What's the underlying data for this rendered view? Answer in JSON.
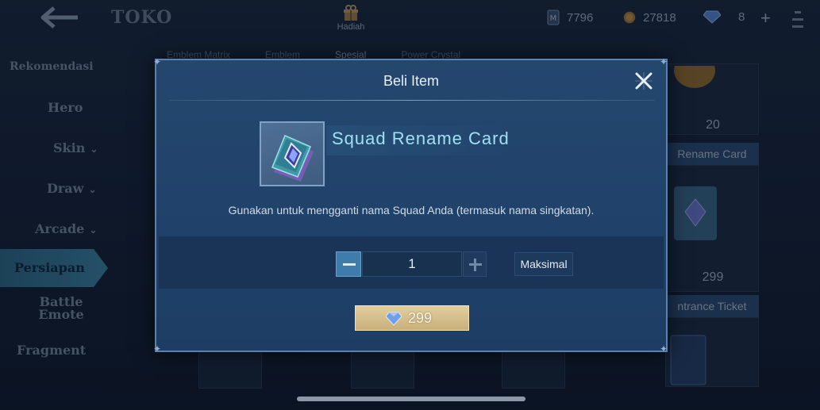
{
  "screen": {
    "title": "TOKO",
    "gift_label": "Hadiah"
  },
  "currencies": [
    {
      "name": "matrix-token",
      "value": "7796"
    },
    {
      "name": "battle-point",
      "value": "27818"
    },
    {
      "name": "diamond",
      "value": "8"
    }
  ],
  "sidebar": {
    "items": [
      {
        "label": "Rekomendasi"
      },
      {
        "label": "Hero"
      },
      {
        "label": "Skin"
      },
      {
        "label": "Draw"
      },
      {
        "label": "Arcade"
      },
      {
        "label": "Persiapan"
      },
      {
        "label": "Battle Emote"
      },
      {
        "label": "Fragment"
      }
    ]
  },
  "tabs": [
    "Emblem Matrix",
    "Emblem",
    "Spesial",
    "Power Crystal"
  ],
  "background_cards": {
    "price_1": "20",
    "name_2": "Rename Card",
    "price_2": "299",
    "name_3": "ntrance Ticket"
  },
  "modal": {
    "title": "Beli Item",
    "item_name": "Squad Rename Card",
    "description": "Gunakan untuk mengganti nama Squad Anda (termasuk nama singkatan).",
    "quantity": "1",
    "max_label": "Maksimal",
    "price": "299"
  },
  "colors": {
    "modal_bg": "#21446c",
    "accent_cyan": "#9fe1f2",
    "buy_button": "#d6bf8c",
    "minus_button": "#3e7dab"
  }
}
